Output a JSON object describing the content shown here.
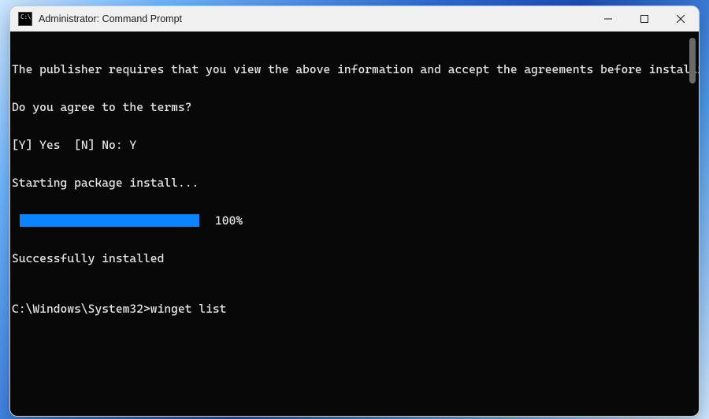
{
  "window": {
    "title": "Administrator: Command Prompt",
    "icon_name": "cmd-icon"
  },
  "controls": {
    "minimize": "Minimize",
    "maximize": "Maximize",
    "close": "Close"
  },
  "terminal": {
    "lines": [
      "The publisher requires that you view the above information and accept the agreements before installing.",
      "Do you agree to the terms?",
      "[Y] Yes  [N] No: Y",
      "Starting package install..."
    ],
    "progress": {
      "percent_label": "100%",
      "percent_value": 100,
      "bar_color": "#0a84ff"
    },
    "post_line": "Successfully installed",
    "prompt": {
      "path": "C:\\Windows\\System32>",
      "command": "winget list"
    }
  }
}
